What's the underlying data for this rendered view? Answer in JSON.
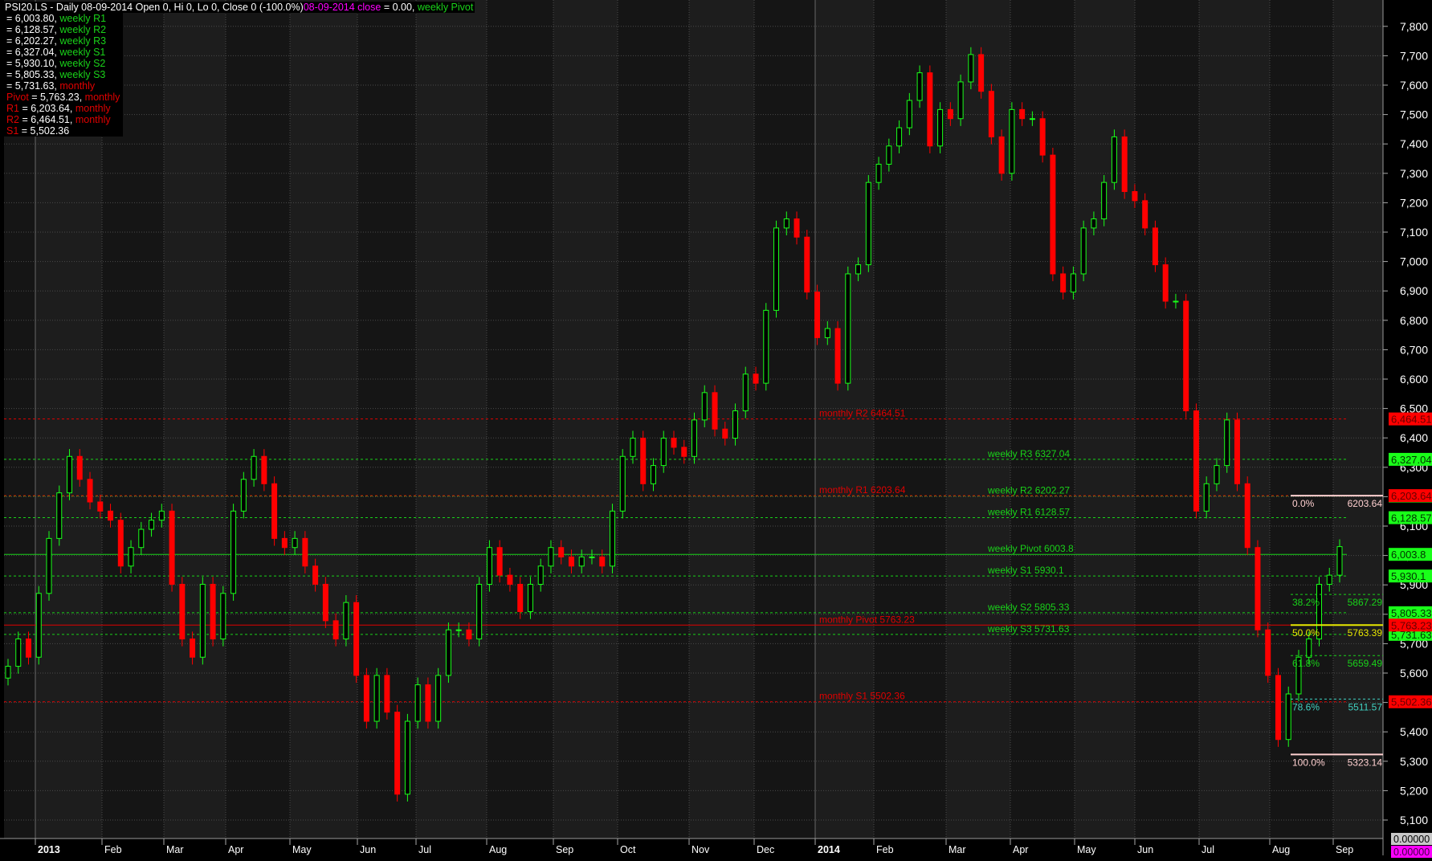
{
  "legend": {
    "title": "PSI20.LS - Daily 08-09-2014 Open 0, Hi 0, Lo 0, Close 0 (-100.0%)",
    "close_label": "08-09-2014 close",
    "close_value": " = 0.00, ",
    "close_series": "weekly Pivot",
    "rows": [
      {
        "prefix": "",
        "value": " = 6,003.80, ",
        "name": "weekly R1",
        "color": "green"
      },
      {
        "prefix": "",
        "value": " = 6,128.57, ",
        "name": "weekly R2",
        "color": "green"
      },
      {
        "prefix": "",
        "value": " = 6,202.27, ",
        "name": "weekly R3",
        "color": "green"
      },
      {
        "prefix": "",
        "value": " = 6,327.04, ",
        "name": "weekly S1",
        "color": "green"
      },
      {
        "prefix": "",
        "value": " = 5,930.10, ",
        "name": "weekly S2",
        "color": "green"
      },
      {
        "prefix": "",
        "value": " = 5,805.33, ",
        "name": "weekly S3",
        "color": "green"
      },
      {
        "prefix": "",
        "value": " = 5,731.63, ",
        "name": "monthly",
        "color": "red"
      },
      {
        "prefix": "Pivot",
        "value": " = 5,763.23, ",
        "name": "monthly",
        "color": "red"
      },
      {
        "prefix": "R1",
        "value": " = 6,203.64, ",
        "name": "monthly",
        "color": "red"
      },
      {
        "prefix": "R2",
        "value": " = 6,464.51, ",
        "name": "monthly",
        "color": "red"
      },
      {
        "prefix": "S1",
        "value": " = 5,502.36",
        "name": "",
        "color": "red"
      }
    ]
  },
  "chart_data": {
    "type": "candlestick",
    "symbol": "PSI20.LS",
    "ylim": [
      5037,
      7900
    ],
    "yticks": [
      5100,
      5200,
      5300,
      5400,
      5500,
      5600,
      5700,
      5800,
      5900,
      6000,
      6100,
      6200,
      6300,
      6400,
      6500,
      6600,
      6700,
      6800,
      6900,
      7000,
      7100,
      7200,
      7300,
      7400,
      7500,
      7600,
      7700,
      7800
    ],
    "ytick_labels": [
      "5,100",
      "5,200",
      "5,300",
      "5,400",
      "5,500",
      "5,600",
      "5,700",
      "5,800",
      "5,900",
      "6,000",
      "6,100",
      "6,200",
      "6,300",
      "6,400",
      "6,500",
      "6,600",
      "6,700",
      "6,800",
      "6,900",
      "7,000",
      "7,100",
      "7,200",
      "7,300",
      "7,400",
      "7,500",
      "7,600",
      "7,700",
      "7,800"
    ],
    "xticks": [
      "2013",
      "Feb",
      "Mar",
      "Apr",
      "May",
      "Jun",
      "Jul",
      "Aug",
      "Sep",
      "Oct",
      "Nov",
      "Dec",
      "2014",
      "Feb",
      "Mar",
      "Apr",
      "May",
      "Jun",
      "Jul",
      "Aug",
      "Sep"
    ],
    "close": [
      5623,
      5716,
      5654,
      5871,
      6058,
      6213,
      6337,
      6259,
      6182,
      6151,
      6120,
      5964,
      6027,
      6089,
      6120,
      6151,
      5902,
      5716,
      5654,
      5902,
      5716,
      5871,
      6151,
      6259,
      6337,
      6244,
      6058,
      6027,
      6058,
      5964,
      5902,
      5778,
      5716,
      5840,
      5592,
      5436,
      5592,
      5467,
      5188,
      5436,
      5560,
      5436,
      5592,
      5747,
      5747,
      5716,
      5902,
      6027,
      5933,
      5902,
      5809,
      5902,
      5964,
      6027,
      5995,
      5964,
      5995,
      5995,
      5964,
      6151,
      6337,
      6399,
      6244,
      6306,
      6399,
      6368,
      6337,
      6461,
      6554,
      6430,
      6399,
      6492,
      6617,
      6586,
      6834,
      7114,
      7145,
      7083,
      6896,
      6741,
      6772,
      6586,
      6958,
      6989,
      7269,
      7331,
      7393,
      7455,
      7548,
      7642,
      7393,
      7517,
      7486,
      7611,
      7704,
      7579,
      7424,
      7300,
      7517,
      7486,
      7486,
      7362,
      6958,
      6896,
      6958,
      7114,
      7145,
      7269,
      7424,
      7238,
      7207,
      7114,
      6989,
      6865,
      6865,
      6492,
      6151,
      6244,
      6306,
      6461,
      6244,
      6027,
      5747,
      5592,
      5374,
      5529,
      5654,
      5716,
      5902,
      5933,
      6030
    ],
    "levels": [
      {
        "label": "weekly R3 6327.04",
        "value": 6327.04,
        "badge": "6,327.04",
        "color": "#19d219",
        "style": "dashed",
        "group": "weekly"
      },
      {
        "label": "weekly R2 6202.27",
        "value": 6202.27,
        "badge": "6,202.27",
        "color": "#19d219",
        "style": "dashed",
        "group": "weekly"
      },
      {
        "label": "weekly R1 6128.57",
        "value": 6128.57,
        "badge": "6,128.57",
        "color": "#19d219",
        "style": "dashed",
        "group": "weekly"
      },
      {
        "label": "weekly Pivot 6003.8",
        "value": 6003.8,
        "badge": "6,003.8",
        "color": "#19d219",
        "style": "solid",
        "group": "weekly"
      },
      {
        "label": "weekly S1 5930.1",
        "value": 5930.1,
        "badge": "5,930.1",
        "color": "#19d219",
        "style": "dashed",
        "group": "weekly"
      },
      {
        "label": "weekly S2 5805.33",
        "value": 5805.33,
        "badge": "5,805.33",
        "color": "#19d219",
        "style": "dashed",
        "group": "weekly"
      },
      {
        "label": "weekly S3 5731.63",
        "value": 5731.63,
        "badge": "5,731.63",
        "color": "#19d219",
        "style": "dashed",
        "group": "weekly"
      },
      {
        "label": "monthly R2 6464.51",
        "value": 6464.51,
        "badge": "6,464.51",
        "color": "#e00000",
        "style": "dashed",
        "group": "monthly"
      },
      {
        "label": "monthly R1 6203.64",
        "value": 6203.64,
        "badge": "6,203.64",
        "color": "#e00000",
        "style": "dashed",
        "group": "monthly"
      },
      {
        "label": "monthly Pivot 5763.23",
        "value": 5763.23,
        "badge": "5,763.23",
        "color": "#e00000",
        "style": "solid",
        "group": "monthly"
      },
      {
        "label": "monthly S1 5502.36",
        "value": 5502.36,
        "badge": "5,502.36",
        "color": "#e00000",
        "style": "dashed",
        "group": "monthly"
      }
    ],
    "fibonacci": [
      {
        "pct": "0.0%",
        "value": "6203.64",
        "price": 6203.64,
        "color": "#ffd0d0",
        "style": "solid"
      },
      {
        "pct": "38.2%",
        "value": "5867.29",
        "price": 5867.29,
        "color": "#19d219",
        "style": "dashed"
      },
      {
        "pct": "50.0%",
        "value": "5763.39",
        "price": 5763.39,
        "color": "#e8e800",
        "style": "solid"
      },
      {
        "pct": "61.8%",
        "value": "5659.49",
        "price": 5659.49,
        "color": "#19d219",
        "style": "dashed"
      },
      {
        "pct": "78.6%",
        "value": "5511.57",
        "price": 5511.57,
        "color": "#40d0c0",
        "style": "dashed"
      },
      {
        "pct": "100.0%",
        "value": "5323.14",
        "price": 5323.14,
        "color": "#ffd0d0",
        "style": "solid"
      }
    ],
    "bottom_badges": [
      {
        "text": "0.00000",
        "color": "#c8c8c8"
      },
      {
        "text": "0.00000",
        "color": "#ff00ff"
      }
    ],
    "colors": {
      "up": "#19ff19",
      "down": "#ff0000"
    }
  }
}
